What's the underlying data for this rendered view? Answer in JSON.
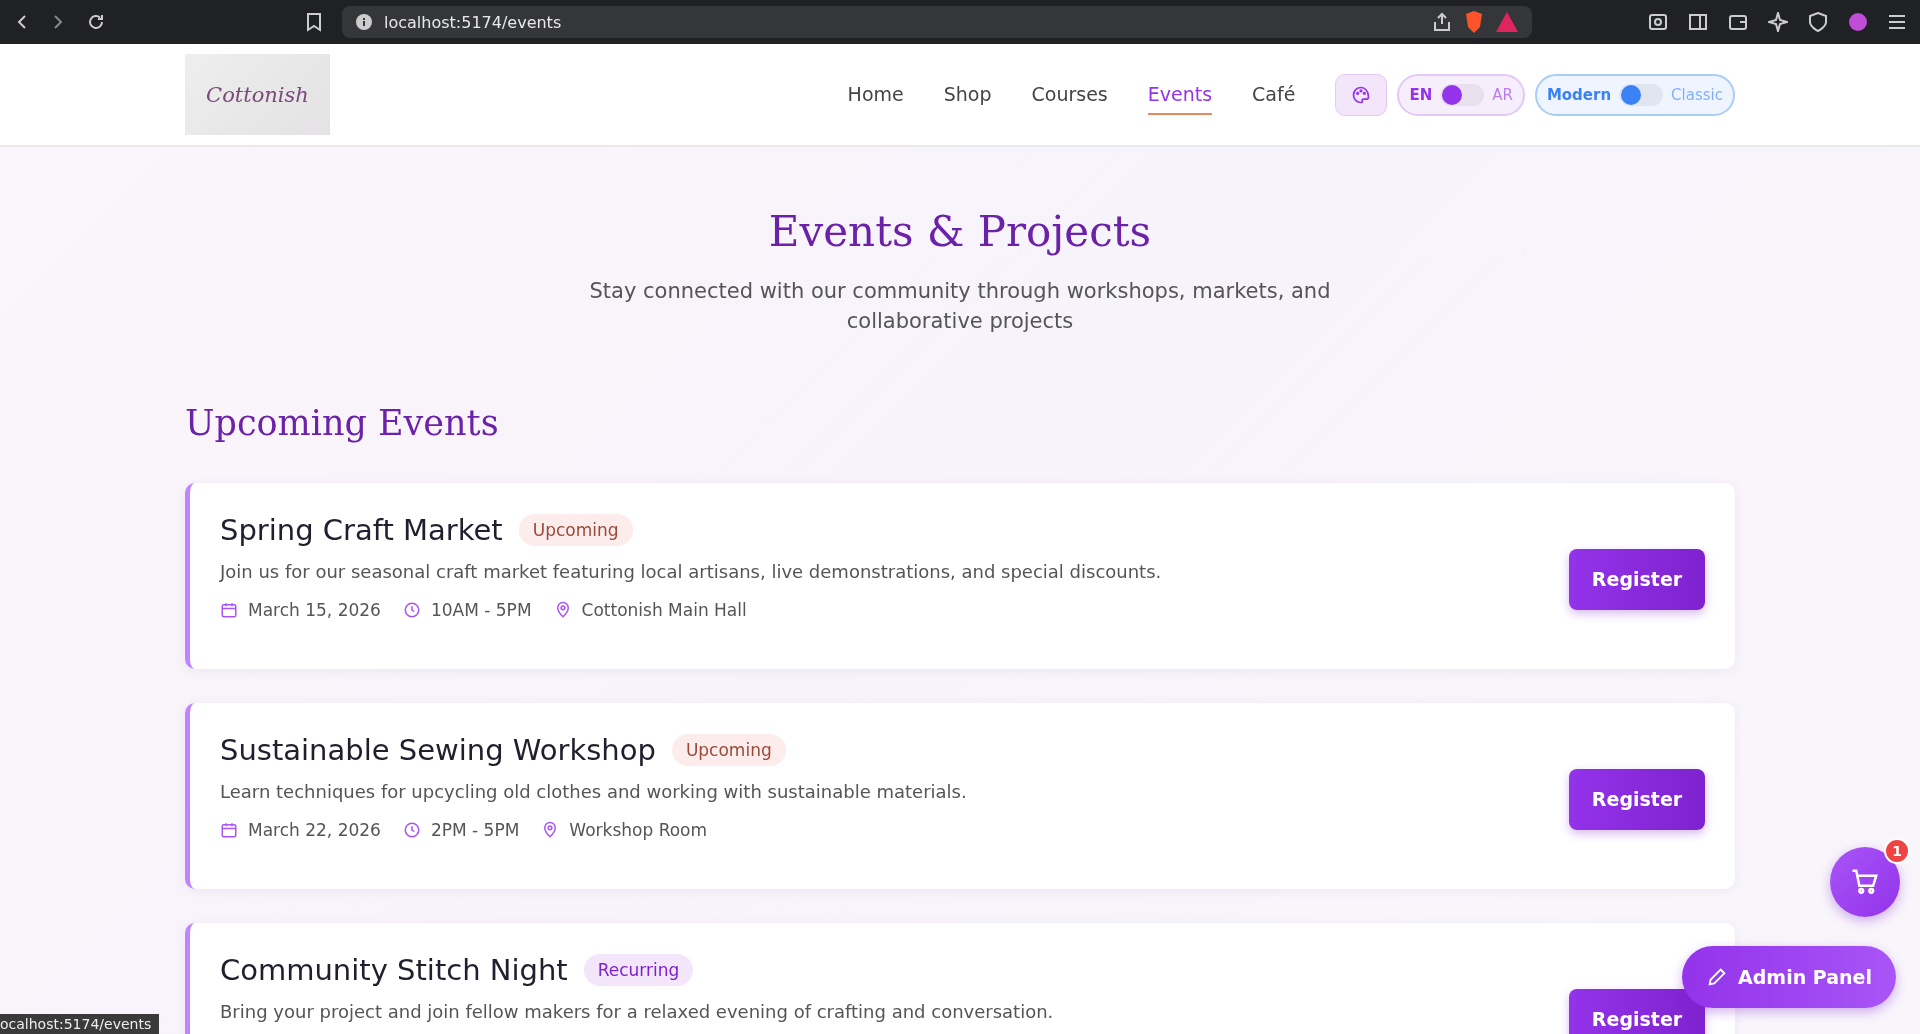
{
  "browser": {
    "url": "localhost:5174/events",
    "status_link": "ocalhost:5174/events"
  },
  "header": {
    "logo": "Cottonish",
    "nav": [
      {
        "label": "Home",
        "selected": false
      },
      {
        "label": "Shop",
        "selected": false
      },
      {
        "label": "Courses",
        "selected": false
      },
      {
        "label": "Events",
        "selected": true
      },
      {
        "label": "Café",
        "selected": false
      }
    ],
    "language_toggle": {
      "left": "EN",
      "right": "AR",
      "on": false
    },
    "style_toggle": {
      "left": "Modern",
      "right": "Classic",
      "on": false
    }
  },
  "hero": {
    "title": "Events & Projects",
    "subtitle": "Stay connected with our community through workshops, markets, and collaborative projects"
  },
  "section_title": "Upcoming Events",
  "events": [
    {
      "title": "Spring Craft Market",
      "badge": "Upcoming",
      "kind": "upcoming",
      "description": "Join us for our seasonal craft market featuring local artisans, live demonstrations, and special discounts.",
      "date": "March 15, 2026",
      "time": "10AM - 5PM",
      "location": "Cottonish Main Hall",
      "button": "Register"
    },
    {
      "title": "Sustainable Sewing Workshop",
      "badge": "Upcoming",
      "kind": "upcoming",
      "description": "Learn techniques for upcycling old clothes and working with sustainable materials.",
      "date": "March 22, 2026",
      "time": "2PM - 5PM",
      "location": "Workshop Room",
      "button": "Register"
    },
    {
      "title": "Community Stitch Night",
      "badge": "Recurring",
      "kind": "recurring",
      "description": "Bring your project and join fellow makers for a relaxed evening of crafting and conversation.",
      "button": "Register"
    }
  ],
  "cart": {
    "count": "1"
  },
  "admin_button": "Admin Panel"
}
